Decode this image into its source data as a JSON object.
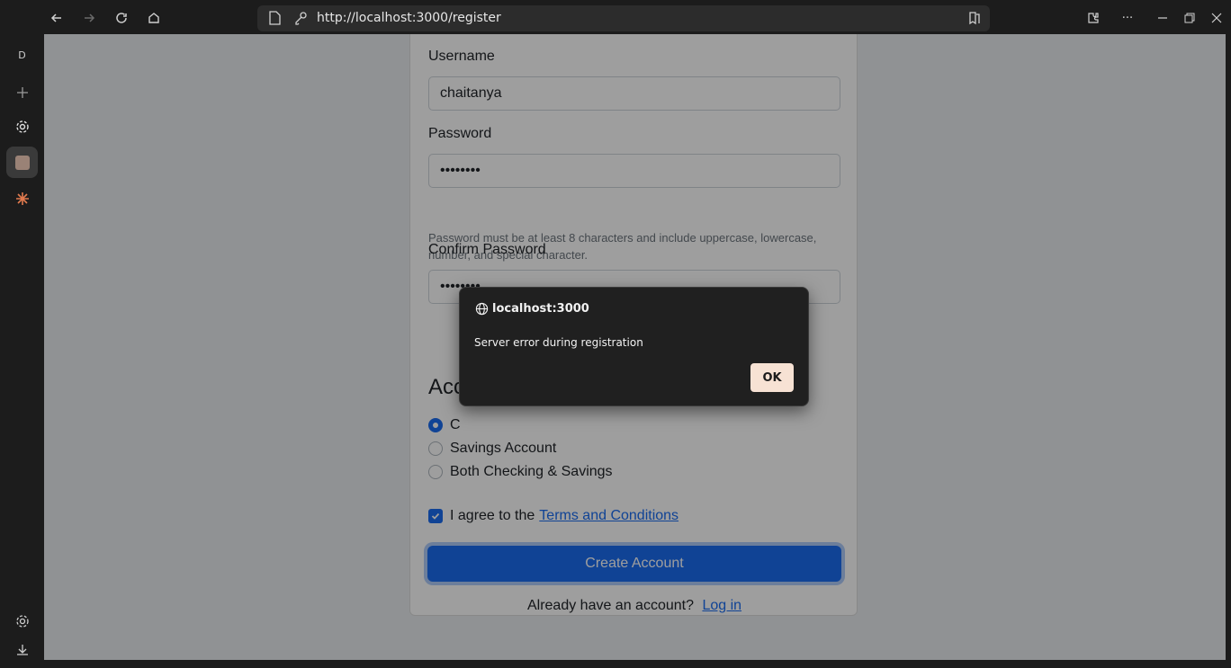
{
  "browser": {
    "url": "http://localhost:3000/register",
    "profile_initial": "D"
  },
  "form": {
    "username_label": "Username",
    "username_value": "chaitanya",
    "password_label": "Password",
    "password_value": "••••••••",
    "password_hint": "Password must be at least 8 characters and include uppercase, lowercase, number, and special character.",
    "confirm_label": "Confirm Password",
    "confirm_value": "••••••••",
    "account_section_title": "Acc",
    "radio_options": [
      "C",
      "Savings Account",
      "Both Checking & Savings"
    ],
    "selected_option_index": 0,
    "terms_prefix": "I agree to the",
    "terms_link": "Terms and Conditions",
    "terms_checked": true,
    "submit_label": "Create Account",
    "login_prefix": "Already have an account?",
    "login_link": "Log in"
  },
  "dialog": {
    "origin": "localhost:3000",
    "message": "Server error during registration",
    "ok_label": "OK"
  },
  "colors": {
    "accent": "#1a6cf0",
    "dialog_bg": "#202020",
    "ok_button": "#f7e2d4"
  }
}
